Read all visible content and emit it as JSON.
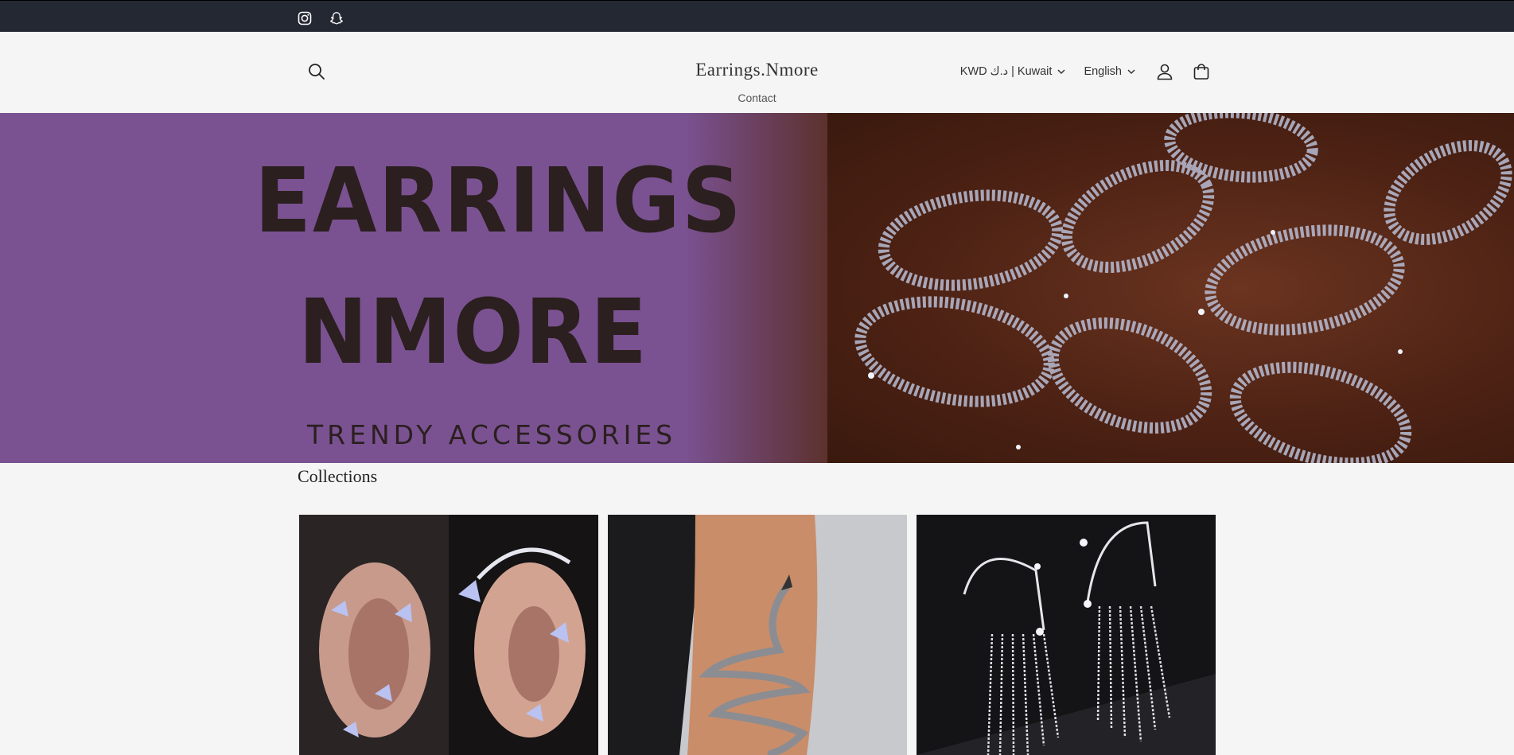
{
  "social": {
    "instagram_icon": "instagram-icon",
    "snapchat_icon": "snapchat-icon"
  },
  "header": {
    "brand": "Earrings.Nmore",
    "currency": "KWD د.ك | Kuwait",
    "language": "English",
    "nav_contact": "Contact"
  },
  "hero": {
    "title_line1": "EARRINGS",
    "title_line2": "NMORE",
    "subtitle": "TRENDY ACCESSORIES",
    "colors": {
      "purple": "#7a5291",
      "brown": "#4d2214",
      "text": "#2b1f1f"
    }
  },
  "collections": {
    "title": "Collections"
  },
  "colors": {
    "topbar": "#242833",
    "page_bg": "#f5f5f5"
  }
}
